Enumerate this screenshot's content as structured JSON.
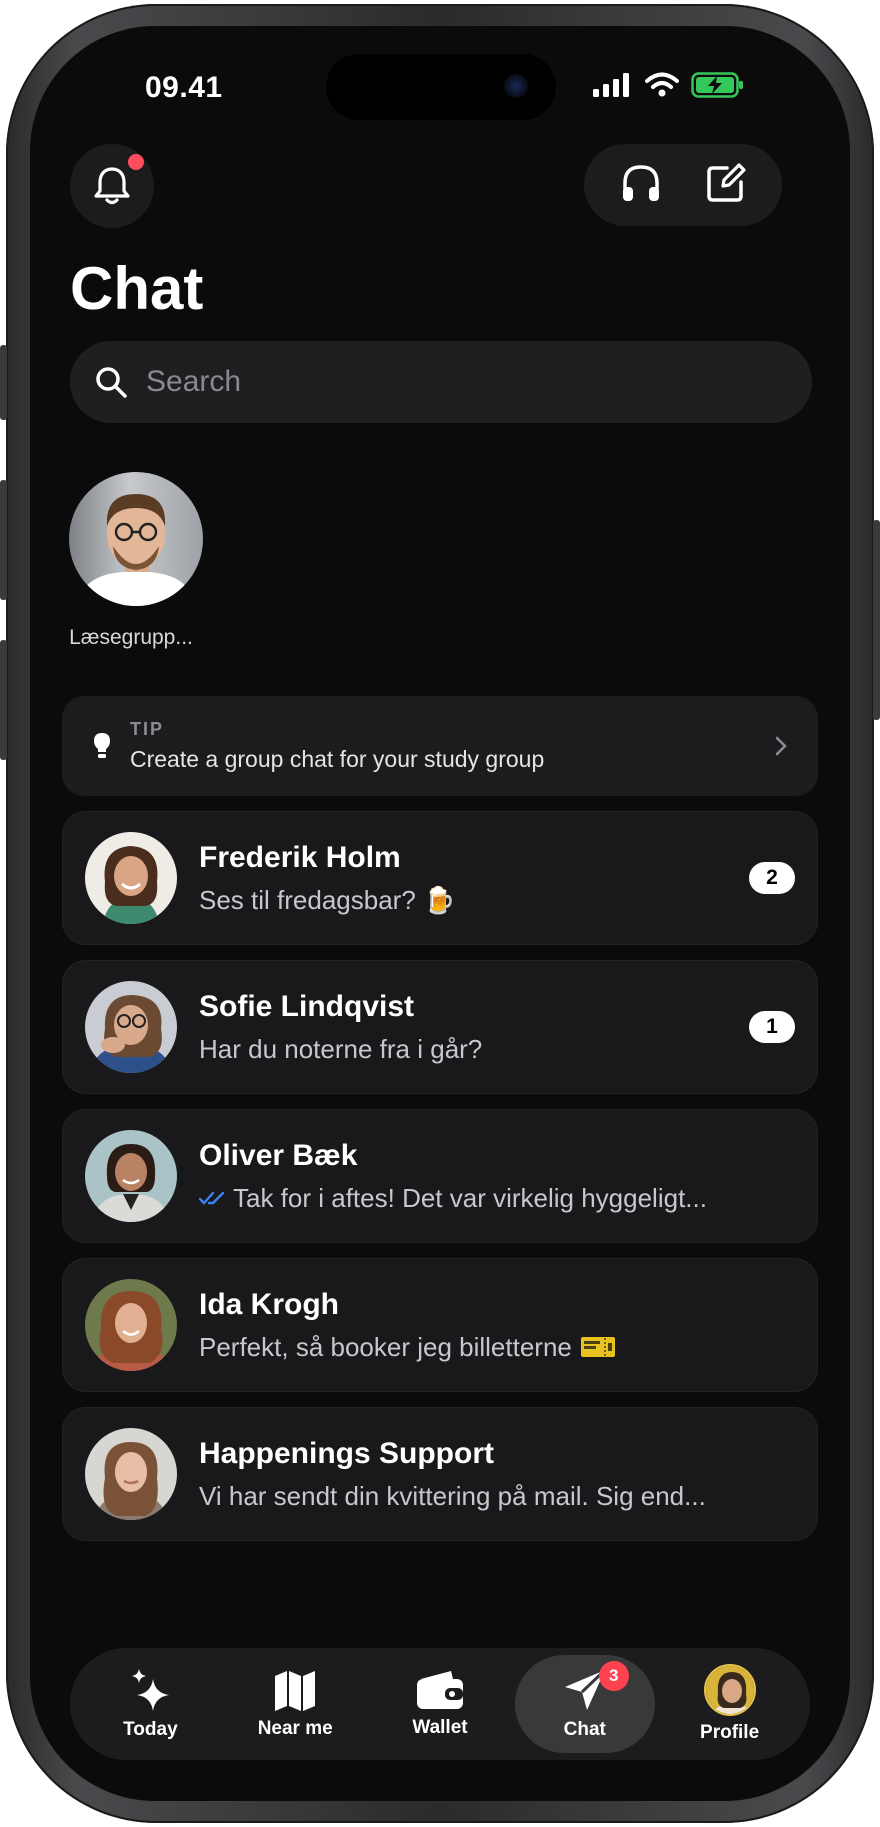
{
  "status_bar": {
    "time": "09.41"
  },
  "header": {
    "title": "Chat"
  },
  "search": {
    "placeholder": "Search"
  },
  "stories": [
    {
      "label": "Læsegrupp..."
    }
  ],
  "tip": {
    "kicker": "TIP",
    "text": "Create a group chat for your study group"
  },
  "chats": [
    {
      "name": "Frederik Holm",
      "preview": "Ses til fredagsbar? 🍺",
      "unread": "2"
    },
    {
      "name": "Sofie Lindqvist",
      "preview": "Har du noterne fra i går?",
      "unread": "1"
    },
    {
      "name": "Oliver Bæk",
      "preview": "Tak for i aftes! Det var virkelig hyggeligt...",
      "read_receipt": true
    },
    {
      "name": "Ida Krogh",
      "preview": "Perfekt, så booker jeg billetterne",
      "icon": "ticket-icon"
    },
    {
      "name": "Happenings Support",
      "preview": "Vi har sendt din kvittering på mail. Sig end..."
    }
  ],
  "tabbar": {
    "items": [
      {
        "label": "Today",
        "icon": "sparkles-icon"
      },
      {
        "label": "Near me",
        "icon": "map-icon"
      },
      {
        "label": "Wallet",
        "icon": "wallet-icon"
      },
      {
        "label": "Chat",
        "icon": "send-icon",
        "badge": "3",
        "active": true
      },
      {
        "label": "Profile",
        "icon": "avatar"
      }
    ]
  },
  "colors": {
    "background": "#0b0b0c",
    "card": "#19191b",
    "badge_red": "#ff4250",
    "read_check": "#3b82f6",
    "battery_green": "#34c759"
  }
}
